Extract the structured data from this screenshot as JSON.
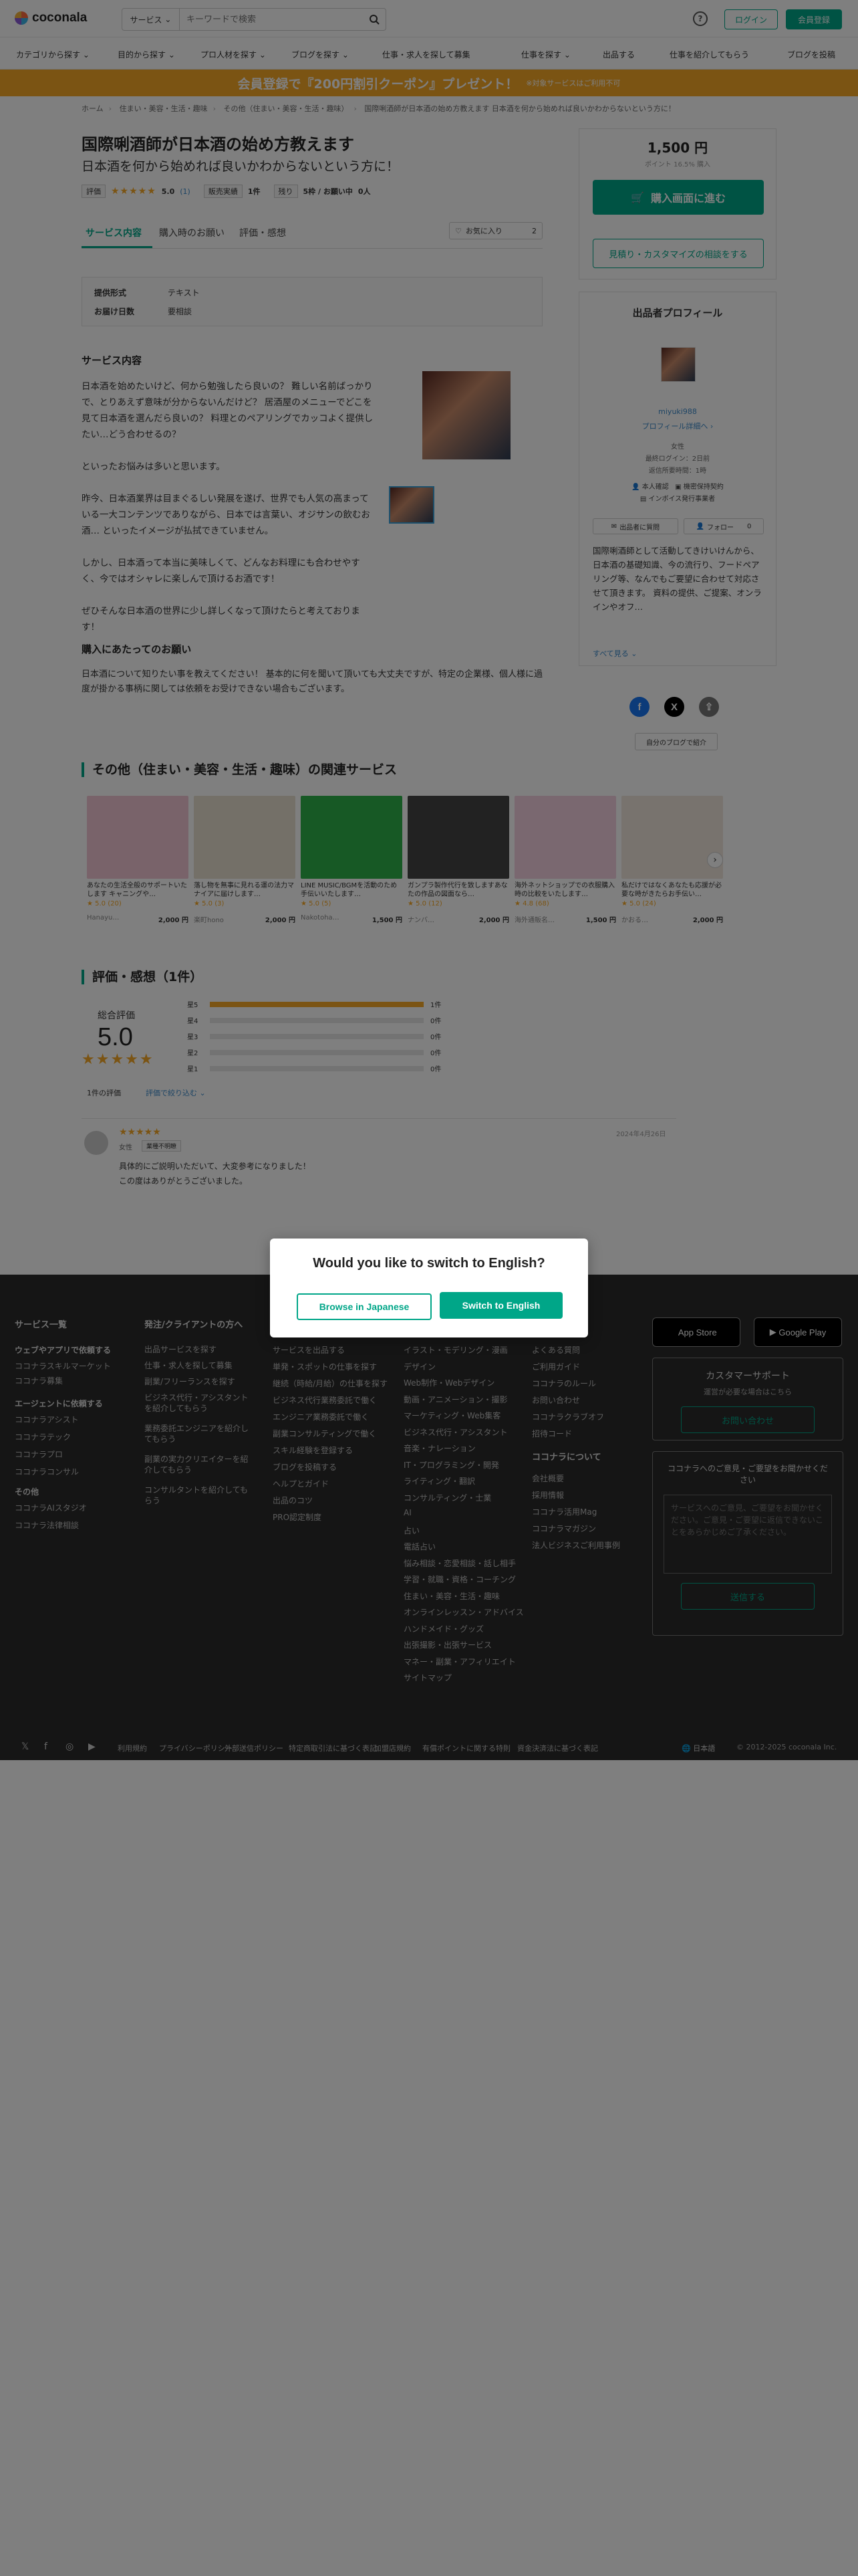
{
  "header": {
    "logo": "coconala",
    "search_category": "サービス",
    "search_placeholder": "キーワードで検索",
    "help": "?",
    "login": "ログイン",
    "signup": "会員登録"
  },
  "nav": [
    "カテゴリから探す",
    "目的から探す",
    "プロ人材を探す",
    "ブログを探す",
    "仕事・求人を探して募集",
    "仕事を探す",
    "出品する",
    "仕事を紹介してもらう",
    "ブログを投稿"
  ],
  "banner": {
    "main": "会員登録で『200円割引クーポン』プレゼント！",
    "sub": "※対象サービスはご利用不可"
  },
  "breadcrumb": [
    "ホーム",
    "住まい・美容・生活・趣味",
    "その他（住まい・美容・生活・趣味）",
    "国際唎酒師が日本酒の始め方教えます 日本酒を何から始めれば良いかわからないという方に！"
  ],
  "service": {
    "title": "国際唎酒師が日本酒の始め方教えます",
    "subtitle": "日本酒を何から始めれば良いかわからないという方に！",
    "rating_tag": "評価",
    "stars": "★★★★★",
    "rating_value": "5.0",
    "rating_count": "(1)",
    "sales_tag": "販売実績",
    "sales_value": "1件",
    "remaining_tag": "残り",
    "remaining_value": "5枠 / お願い中",
    "waiting_value": "0人"
  },
  "tabs": {
    "t1": "サービス内容",
    "t2": "購入時のお願い",
    "t3": "評価・感想",
    "favorite": "お気に入り",
    "favorite_count": "2"
  },
  "spec": {
    "label1": "提供形式",
    "value1": "テキスト",
    "label2": "お届け日数",
    "value2": "要相談"
  },
  "content": {
    "heading": "サービス内容",
    "p1": "日本酒を始めたいけど、何から勉強したら良いの？ 難しい名前ばっかりで、とりあえず意味が分からないんだけど？ 居酒屋のメニューでどこを見て日本酒を選んだら良いの？ 料理とのペアリングでカッコよく提供したい…どう合わせるの？",
    "p2": "といったお悩みは多いと思います。",
    "p3": "昨今、日本酒業界は目まぐるしい発展を遂げ、世界でも人気の高まっている一大コンテンツでありながら、日本では言葉い、オジサンの飲むお酒… といったイメージが払拭できていません。",
    "p4": "しかし、日本酒って本当に美味しくて、どんなお料理にも合わせやすく、今ではオシャレに楽しんで頂けるお酒です！",
    "p5": "ぜひそんな日本酒の世界に少し詳しくなって頂けたらと考えております！",
    "purchase_heading": "購入にあたってのお願い",
    "purchase_text": "日本酒について知りたい事を教えてください！ 基本的に何を聞いて頂いても大丈夫ですが、特定の企業様、個人様に過度が掛かる事柄に関しては依頼をお受けできない場合もございます。"
  },
  "price_panel": {
    "price": "1,500 円",
    "price_sub": "ポイント 16.5% 購入",
    "buy": "購入画面に進む",
    "consult": "見積り・カスタマイズの相談をする"
  },
  "profile": {
    "title": "出品者プロフィール",
    "name": "miyuki988",
    "link": "プロフィール詳細へ ›",
    "gender": "女性",
    "last_login": "最終ログイン：2日前",
    "response": "返信所要時間：1時",
    "badge1": "本人確認",
    "badge2": "機密保持契約",
    "badge3": "インボイス発行事業者",
    "msg_btn": "出品者に質問",
    "follow_btn": "フォロー",
    "follow_count": "0",
    "desc": "国際唎酒師として活動してきけいけんから、日本酒の基礎知識、今の流行り、フードペアリング等、なんでもご要望に合わせて対応させて頂きます。 資料の提供、ご提案、オンラインやオフ…",
    "see_more": "すべて見る ⌄",
    "intro": "自分のブログで紹介"
  },
  "related": {
    "heading": "その他（住まい・美容・生活・趣味）の関連サービス",
    "cards": [
      {
        "text": "あなたの生活全般のサポートいたします キャニングや…",
        "rating": "★ 5.0 (20)",
        "seller": "Hanayu…",
        "price": "2,000 円",
        "color": "#f3c7d4"
      },
      {
        "text": "落し物を無事に見れる運の法力マナイアに届けします…",
        "rating": "★ 5.0 (3)",
        "seller": "楽町hono",
        "price": "2,000 円",
        "color": "#e8e0d0"
      },
      {
        "text": "LINE MUSIC/BGMを活動のため手伝いいたします…",
        "rating": "★ 5.0 (5)",
        "seller": "Nakotoha…",
        "price": "1,500 円",
        "color": "#2fb34a"
      },
      {
        "text": "ガンプラ製作代行を致しますあなたの作品の図面なら…",
        "rating": "★ 5.0 (12)",
        "seller": "ナンバ…",
        "price": "2,000 円",
        "color": "#444444"
      },
      {
        "text": "海外ネットショップでの衣服購入時の比較をいたします…",
        "rating": "★ 4.8 (68)",
        "seller": "海外通販名…",
        "price": "1,500 円",
        "color": "#f5d0e0"
      },
      {
        "text": "私だけではなくあなたも応援が必要な時がきたらお手伝い…",
        "rating": "★ 5.0 (24)",
        "seller": "かおる…",
        "price": "2,000 円",
        "color": "#f0e6dc"
      }
    ]
  },
  "reviews": {
    "heading": "評価・感想（1件）",
    "score_label": "総合評価",
    "score": "5.0",
    "stars": "★★★★★",
    "bars": [
      {
        "label": "星5",
        "count": "1件",
        "fill": 1.0
      },
      {
        "label": "星4",
        "count": "0件",
        "fill": 0
      },
      {
        "label": "星3",
        "count": "0件",
        "fill": 0
      },
      {
        "label": "星2",
        "count": "0件",
        "fill": 0
      },
      {
        "label": "星1",
        "count": "0件",
        "fill": 0
      }
    ],
    "count_text": "1件の評価",
    "filter": "評価で絞り込む ⌄",
    "item": {
      "stars": "★★★★★",
      "gender": "女性",
      "tag": "業種不明瞭",
      "date": "2024年4月26日",
      "comment": "具体的にご説明いただいて、大変参考になりました！",
      "reply": "この度はありがとうございました。"
    }
  },
  "footer": {
    "col1_h": "サービス一覧",
    "col1_sub1": "ウェブやアプリで依頼する",
    "col1_links1": [
      "ココナラスキルマーケット",
      "ココナラ募集"
    ],
    "col1_sub2": "エージェントに依頼する",
    "col1_links2": [
      "ココナラアシスト",
      "ココナラテック",
      "ココナラプロ",
      "ココナラコンサル"
    ],
    "col1_sub3": "その他",
    "col1_links3": [
      "ココナラAIスタジオ",
      "ココナラ法律相談"
    ],
    "col2_h": "発注/クライアントの方へ",
    "col2_links": [
      "出品サービスを探す",
      "仕事・求人を探して募集",
      "副業/フリーランスを探す",
      "ビジネス代行・アシスタントを紹介してもらう",
      "業務委託エンジニアを紹介してもらう",
      "副業の実力クリエイターを紹介してもらう",
      "コンサルタントを紹介してもらう"
    ],
    "col3_links": [
      "サービスを出品する",
      "単発・スポットの仕事を探す",
      "継続（時給/月給）の仕事を探す",
      "ビジネス代行業務委託で働く",
      "エンジニア業務委託で働く",
      "副業コンサルティングで働く",
      "スキル経験を登録する",
      "ブログを投稿する",
      "ヘルプとガイド",
      "出品のコツ",
      "PRO認定制度"
    ],
    "col4_links": [
      "イラスト・モデリング・漫画",
      "デザイン",
      "Web制作・Webデザイン",
      "動画・アニメーション・撮影",
      "マーケティング・Web集客",
      "ビジネス代行・アシスタント",
      "音楽・ナレーション",
      "IT・プログラミング・開発",
      "ライティング・翻訳",
      "コンサルティング・士業",
      "AI",
      "占い",
      "電話占い",
      "悩み相談・恋愛相談・話し相手",
      "学習・就職・資格・コーチング",
      "住まい・美容・生活・趣味",
      "オンラインレッスン・アドバイス",
      "ハンドメイド・グッズ",
      "出張撮影・出張サービス",
      "マネー・副業・アフィリエイト",
      "サイトマップ"
    ],
    "col5_links": [
      "よくある質問",
      "ご利用ガイド",
      "ココナラのルール",
      "お問い合わせ",
      "ココナラクラブオフ",
      "招待コード"
    ],
    "col5_h2": "ココナラについて",
    "col5_links2": [
      "会社概要",
      "採用情報",
      "ココナラ活用Mag",
      "ココナラマガジン",
      "法人ビジネスご利用事例"
    ],
    "appstore": "App Store",
    "googleplay": "Google Play",
    "support_title": "カスタマーサポート",
    "support_sub": "運営が必要な場合はこちら",
    "support_btn": "お問い合わせ",
    "feedback_title": "ココナラへのご意見・ご要望をお聞かせください",
    "feedback_placeholder": "サービスへのご意見、ご要望をお聞かせください。ご意見・ご要望に返信できないことをあらかじめご了承ください。",
    "feedback_btn": "送信する",
    "bottom_links": [
      "利用規約",
      "プライバシーポリシー",
      "外部送信ポリシー",
      "特定商取引法に基づく表記",
      "加盟店規約",
      "有償ポイントに関する特則",
      "資金決済法に基づく表記"
    ],
    "language": "日本語",
    "copyright": "© 2012-2025 coconala Inc."
  },
  "modal": {
    "title": "Would you like to switch to English?",
    "browse_jp": "Browse in Japanese",
    "switch_en": "Switch to English"
  }
}
